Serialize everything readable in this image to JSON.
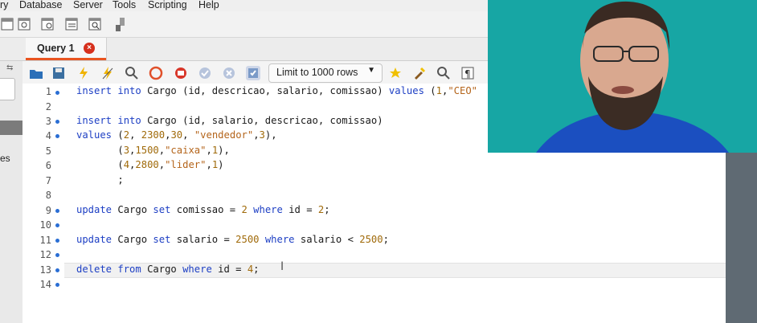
{
  "menu": {
    "items": [
      "ry",
      "Database",
      "Server",
      "Tools",
      "Scripting",
      "Help"
    ]
  },
  "tab": {
    "label": "Query 1",
    "close": "×"
  },
  "left_panel": {
    "partial_text": "es"
  },
  "toolbar2": {
    "limit_label": "Limit to 1000 rows"
  },
  "editor": {
    "line_numbers": [
      "1",
      "2",
      "3",
      "4",
      "5",
      "6",
      "7",
      "8",
      "9",
      "10",
      "11",
      "12",
      "13",
      "14"
    ],
    "current_line": 13
  },
  "colors": {
    "accent": "#e95420",
    "keyword": "#1d3fc4",
    "string": "#b4641a",
    "number": "#a06a0a",
    "webcam_bg": "#1aa7a5"
  },
  "icons": [
    "folder-icon",
    "save-icon",
    "execute-icon",
    "execute-current-icon",
    "explain-icon",
    "stop-icon",
    "toggle-autocommit-icon",
    "commit-icon",
    "rollback-icon",
    "toggle-icon",
    "favorite-icon",
    "beautify-icon",
    "find-icon",
    "invisibles-icon"
  ]
}
